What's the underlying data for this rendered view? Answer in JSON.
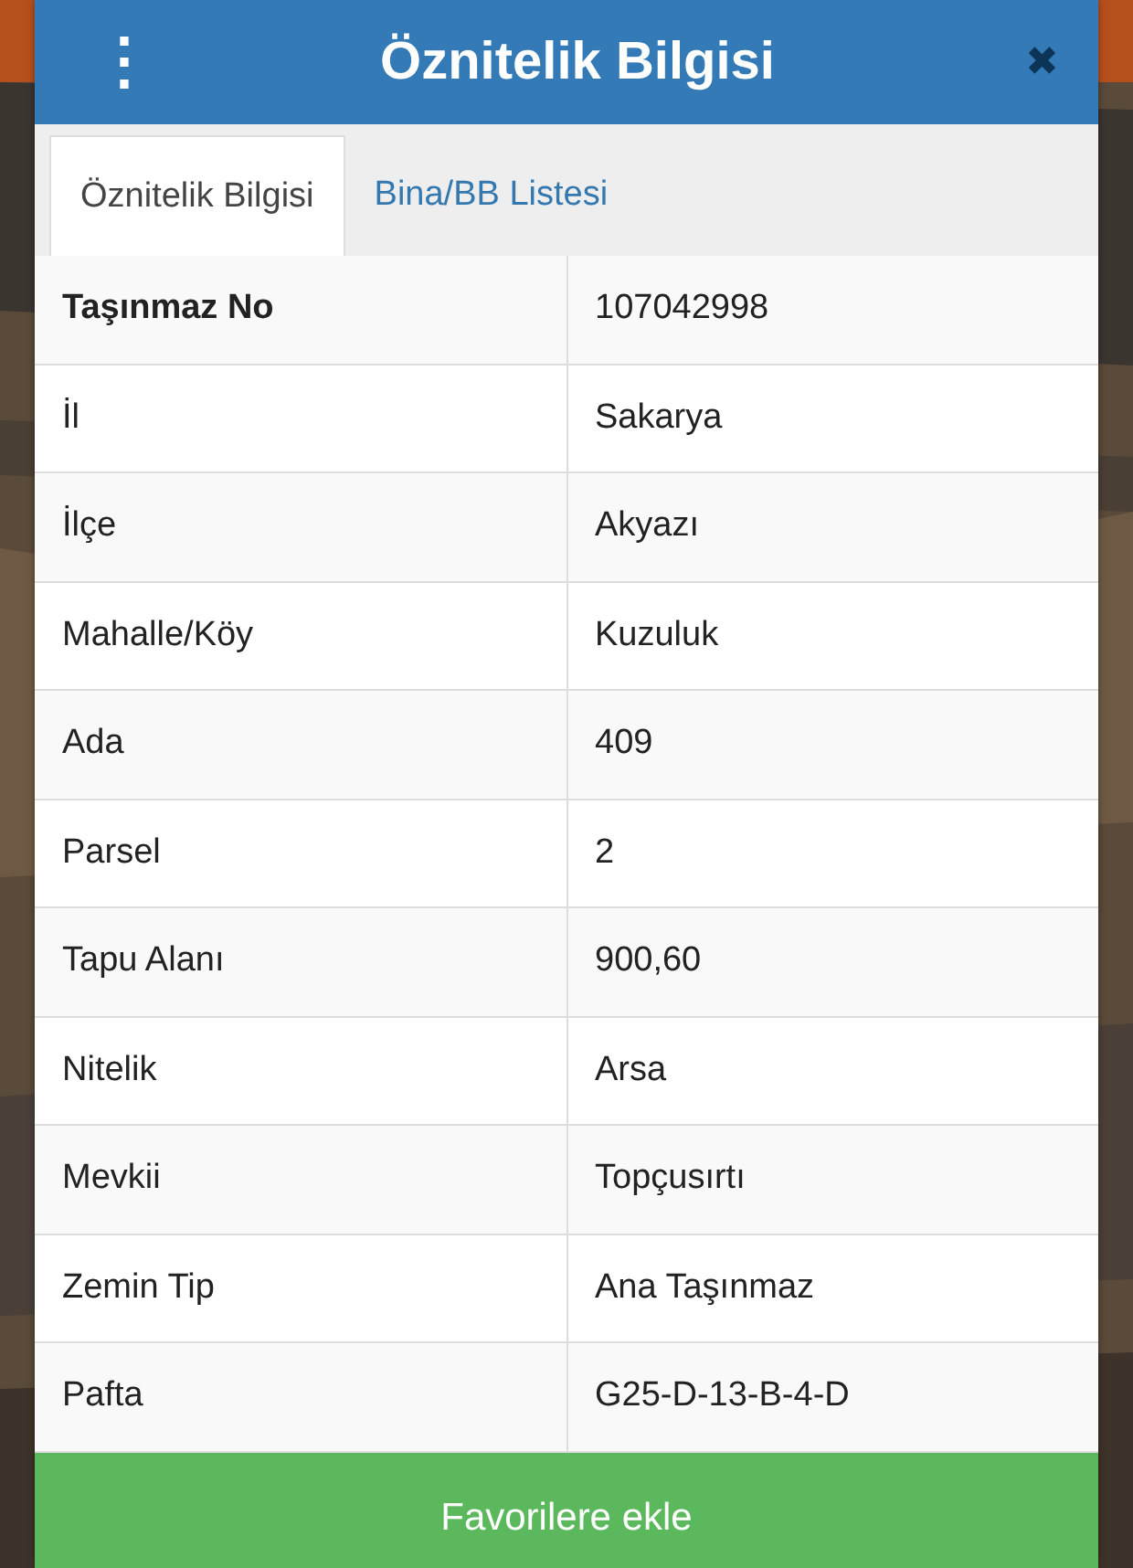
{
  "dialog": {
    "menu_icon": "⋮",
    "title": "Öznitelik Bilgisi",
    "close_icon": "✖"
  },
  "tabs": [
    {
      "label": "Öznitelik Bilgisi",
      "selected": true
    },
    {
      "label": "Bina/BB Listesi",
      "selected": false
    }
  ],
  "table": {
    "rows": [
      {
        "label": "Taşınmaz No",
        "value": "107042998",
        "bold": true
      },
      {
        "label": "İl",
        "value": "Sakarya",
        "bold": false
      },
      {
        "label": "İlçe",
        "value": "Akyazı",
        "bold": false
      },
      {
        "label": "Mahalle/Köy",
        "value": "Kuzuluk",
        "bold": false
      },
      {
        "label": "Ada",
        "value": "409",
        "bold": false
      },
      {
        "label": "Parsel",
        "value": "2",
        "bold": false
      },
      {
        "label": "Tapu Alanı",
        "value": "900,60",
        "bold": false
      },
      {
        "label": "Nitelik",
        "value": "Arsa",
        "bold": false
      },
      {
        "label": "Mevkii",
        "value": "Topçusırtı",
        "bold": false
      },
      {
        "label": "Zemin Tip",
        "value": "Ana Taşınmaz",
        "bold": false
      },
      {
        "label": "Pafta",
        "value": "G25-D-13-B-4-D",
        "bold": false
      }
    ]
  },
  "button": {
    "label": "Favorilere ekle"
  }
}
